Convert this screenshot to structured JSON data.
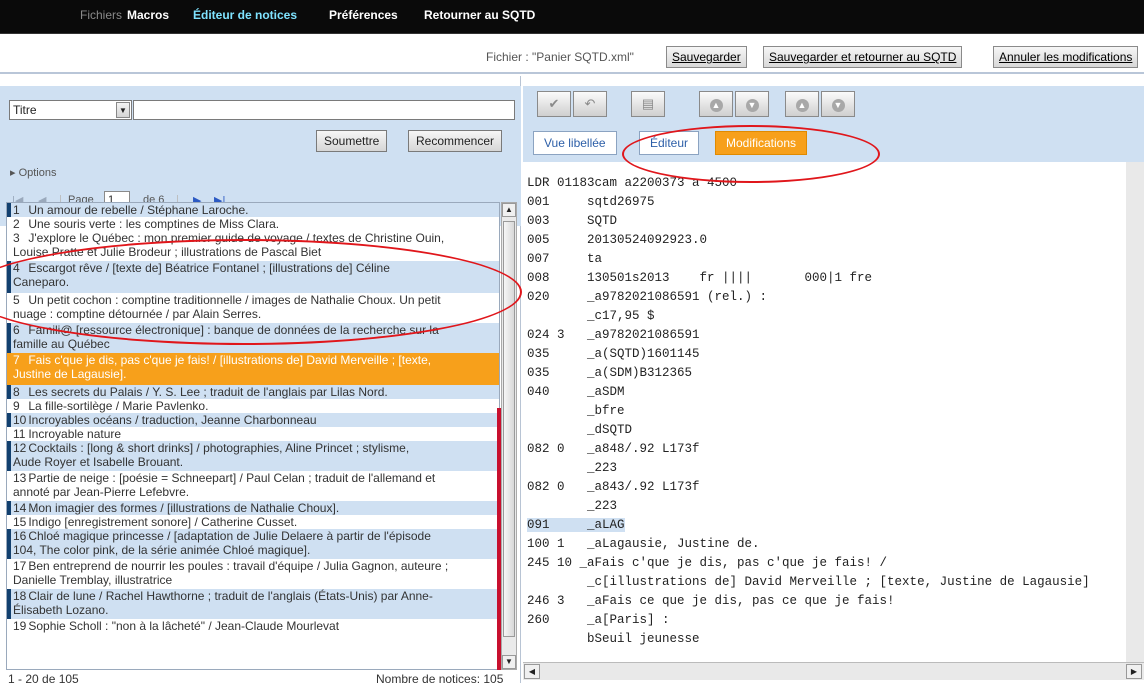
{
  "menu": {
    "items": [
      {
        "label": "Fichiers"
      },
      {
        "label": "Macros"
      },
      {
        "label": "Éditeur de notices"
      },
      {
        "label": "Préférences"
      },
      {
        "label": "Retourner au SQTD"
      }
    ]
  },
  "filebar": {
    "file_label": "Fichier : \"Panier SQTD.xml\"",
    "save": "Sauvegarder",
    "save_return": "Sauvegarder et retourner au SQTD",
    "cancel": "Annuler les modifications"
  },
  "search": {
    "field_selected": "Titre",
    "query": "",
    "submit": "Soumettre",
    "reset": "Recommencer",
    "options": "▸ Options"
  },
  "pager": {
    "page_label": "Page",
    "page_value": "1",
    "of_label": "de 6"
  },
  "results": [
    {
      "n": "1",
      "title": "Un amour de rebelle / Stéphane Laroche."
    },
    {
      "n": "2",
      "title": "Une souris verte : les comptines de Miss Clara."
    },
    {
      "n": "3",
      "title": "J'explore le Québec : mon premier guide de voyage / textes de Christine Ouin,",
      "title2": "Louise Pratte et Julie Brodeur ; illustrations de Pascal Biet"
    },
    {
      "n": "4",
      "title": "Escargot rêve / [texte de] Béatrice Fontanel ; [illustrations de] Céline",
      "title2": "Caneparo."
    },
    {
      "n": "5",
      "title": "Un petit cochon : comptine traditionnelle / images de Nathalie Choux. Un petit",
      "title2": "nuage : comptine détournée / par Alain Serres."
    },
    {
      "n": "6",
      "title": "Famili@ [ressource électronique] : banque de données de la recherche sur la",
      "title2": "famille au Québec"
    },
    {
      "n": "7",
      "title": "Fais c'que je dis, pas c'que je fais! / [illustrations de] David Merveille ; [texte,",
      "title2": "Justine de Lagausie]."
    },
    {
      "n": "8",
      "title": "Les secrets du Palais / Y. S. Lee ; traduit de l'anglais par Lilas Nord."
    },
    {
      "n": "9",
      "title": "La fille-sortilège / Marie Pavlenko."
    },
    {
      "n": "10",
      "title": "Incroyables océans / traduction, Jeanne Charbonneau"
    },
    {
      "n": "11",
      "title": "Incroyable nature"
    },
    {
      "n": "12",
      "title": "Cocktails : [long & short drinks] / photographies, Aline Princet ; stylisme,",
      "title2": "Aude Royer et Isabelle Brouant."
    },
    {
      "n": "13",
      "title": "Partie de neige : [poésie = Schneepart] / Paul Celan ; traduit de l'allemand et",
      "title2": "annoté par Jean-Pierre Lefebvre."
    },
    {
      "n": "14",
      "title": "Mon imagier des formes / [illustrations de Nathalie Choux]."
    },
    {
      "n": "15",
      "title": "Indigo [enregistrement sonore] / Catherine Cusset."
    },
    {
      "n": "16",
      "title": "Chloé magique princesse / [adaptation de Julie Delaere à partir de l'épisode",
      "title2": "104, The color pink, de la série animée Chloé magique]."
    },
    {
      "n": "17",
      "title": "Ben entreprend de nourrir les poules : travail d'équipe / Julia Gagnon, auteure ;",
      "title2": "Danielle Tremblay, illustratrice"
    },
    {
      "n": "18",
      "title": "Clair de lune / Rachel Hawthorne ; traduit de l'anglais (États-Unis) par Anne-",
      "title2": "Élisabeth Lozano."
    },
    {
      "n": "19",
      "title": "Sophie Scholl : \"non à la lâcheté\" / Jean-Claude Mourlevat"
    }
  ],
  "footer": {
    "range": "1 - 20 de 105",
    "count": "Nombre de notices: 105"
  },
  "tabs": [
    {
      "label": "Vue libellée"
    },
    {
      "label": "Éditeur"
    },
    {
      "label": "Modifications"
    }
  ],
  "marc": [
    "LDR 01183cam a2200373 a 4500",
    "001     sqtd26975",
    "003     SQTD",
    "005     20130524092923.0",
    "007     ta",
    "008     130501s2013    fr ||||       000|1 fre",
    "020     _a9782021086591 (rel.) :",
    "        _c17,95 $",
    "024 3   _a9782021086591",
    "035     _a(SQTD)1601145",
    "035     _a(SDM)B312365",
    "040     _aSDM",
    "        _bfre",
    "        _dSQTD",
    "082 0   _a848/.92 L173f",
    "        _223",
    "082 0   _a843/.92 L173f",
    "        _223",
    "091     _aLAG",
    "100 1   _aLagausie, Justine de.",
    "245 10 _aFais c'que je dis, pas c'que je fais! /",
    "        _c[illustrations de] David Merveille ; [texte, Justine de Lagausie]",
    "246 3   _aFais ce que je dis, pas ce que je fais!",
    "260     _a[Paris] :",
    "        bSeuil jeunesse"
  ]
}
